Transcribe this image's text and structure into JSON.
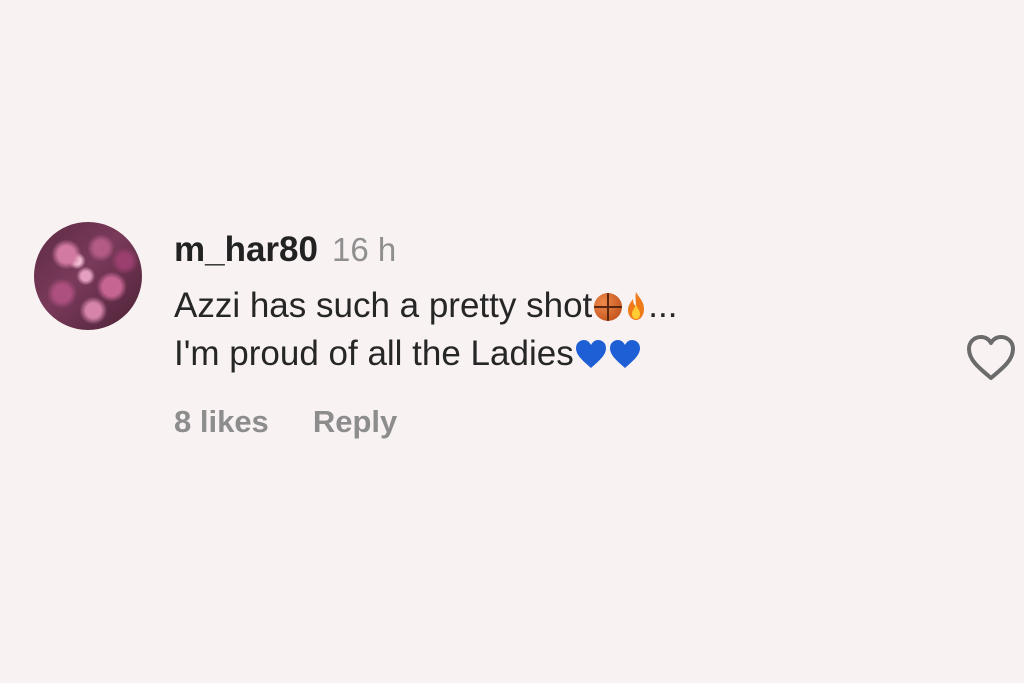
{
  "comment": {
    "username": "m_har80",
    "time": "16 h",
    "text_line_1": "Azzi has such a pretty shot",
    "text_line_1_suffix": "...",
    "text_line_2": "I'm proud of all the Ladies",
    "likes": "8 likes",
    "reply_label": "Reply",
    "emojis_line_1": [
      "basketball-emoji",
      "fire-emoji"
    ],
    "emojis_line_2": [
      "blue-heart-emoji",
      "blue-heart-emoji"
    ]
  },
  "colors": {
    "background": "#f8f2f2",
    "username": "#222222",
    "secondary_text": "#8d8d8d",
    "blue_heart": "#1f5fd6",
    "fire": "#f07a1a"
  }
}
